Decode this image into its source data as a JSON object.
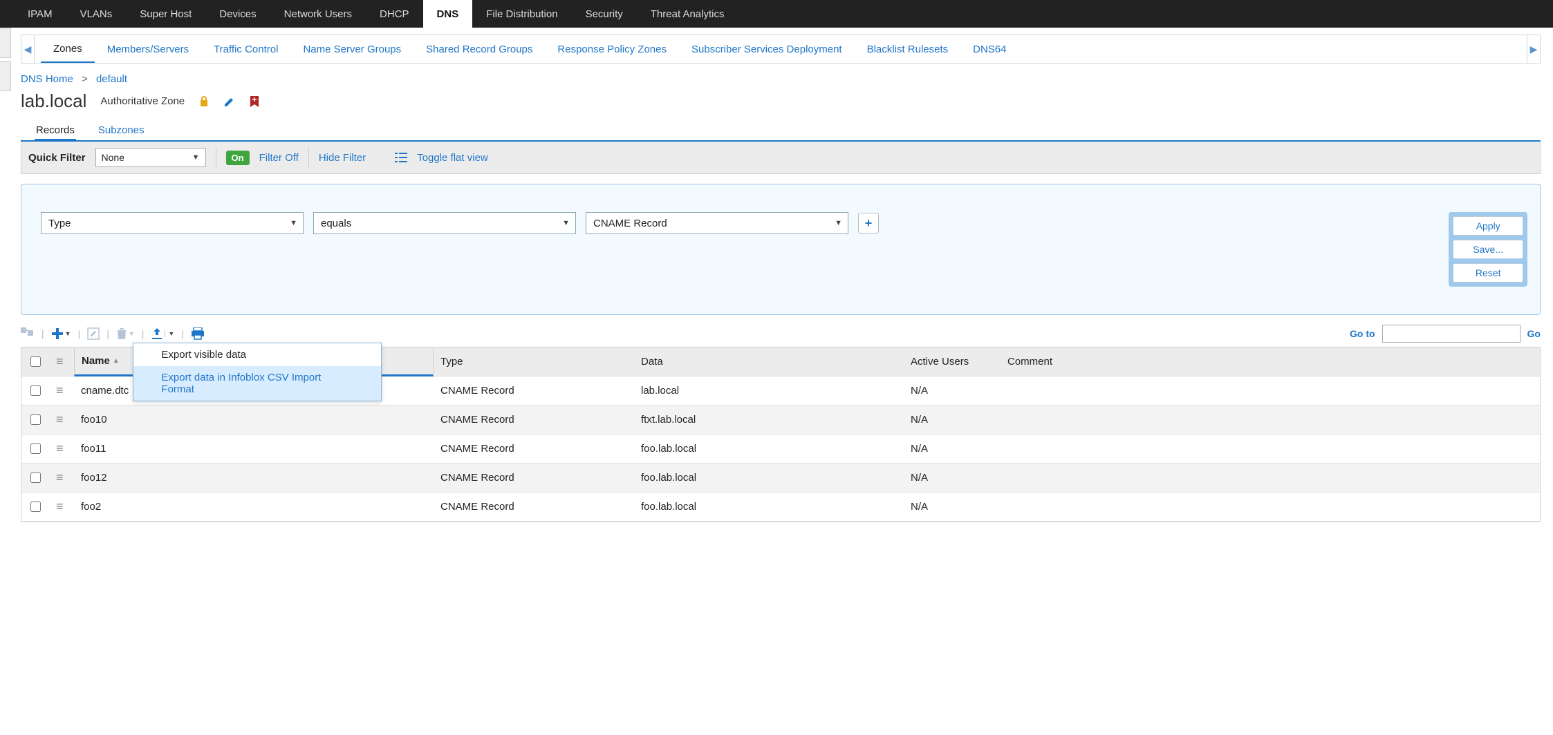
{
  "topnav": [
    "IPAM",
    "VLANs",
    "Super Host",
    "Devices",
    "Network Users",
    "DHCP",
    "DNS",
    "File Distribution",
    "Security",
    "Threat Analytics"
  ],
  "topnav_active": "DNS",
  "subtabs": [
    "Zones",
    "Members/Servers",
    "Traffic Control",
    "Name Server Groups",
    "Shared Record Groups",
    "Response Policy Zones",
    "Subscriber Services Deployment",
    "Blacklist Rulesets",
    "DNS64"
  ],
  "subtab_active": "Zones",
  "breadcrumb": {
    "home": "DNS Home",
    "sep": ">",
    "current": "default"
  },
  "zone": {
    "name": "lab.local",
    "type": "Authoritative Zone"
  },
  "record_tabs": {
    "records": "Records",
    "subzones": "Subzones",
    "active": "Records"
  },
  "quick_filter": {
    "label": "Quick Filter",
    "value": "None",
    "on_badge": "On",
    "filter_off": "Filter Off",
    "hide_filter": "Hide Filter",
    "toggle_flat": "Toggle flat view"
  },
  "filter_box": {
    "field": "Type",
    "op": "equals",
    "value": "CNAME Record",
    "apply": "Apply",
    "save": "Save...",
    "reset": "Reset"
  },
  "export_menu": {
    "visible": "Export visible data",
    "csv": "Export data in Infoblox CSV Import Format"
  },
  "goto": {
    "label": "Go to",
    "go": "Go"
  },
  "columns": {
    "name": "Name",
    "type": "Type",
    "data": "Data",
    "active": "Active Users",
    "comment": "Comment"
  },
  "rows": [
    {
      "name": "cname.dtc",
      "type": "CNAME Record",
      "data": "lab.local",
      "active": "N/A"
    },
    {
      "name": "foo10",
      "type": "CNAME Record",
      "data": "ftxt.lab.local",
      "active": "N/A"
    },
    {
      "name": "foo11",
      "type": "CNAME Record",
      "data": "foo.lab.local",
      "active": "N/A"
    },
    {
      "name": "foo12",
      "type": "CNAME Record",
      "data": "foo.lab.local",
      "active": "N/A"
    },
    {
      "name": "foo2",
      "type": "CNAME Record",
      "data": "foo.lab.local",
      "active": "N/A"
    }
  ]
}
